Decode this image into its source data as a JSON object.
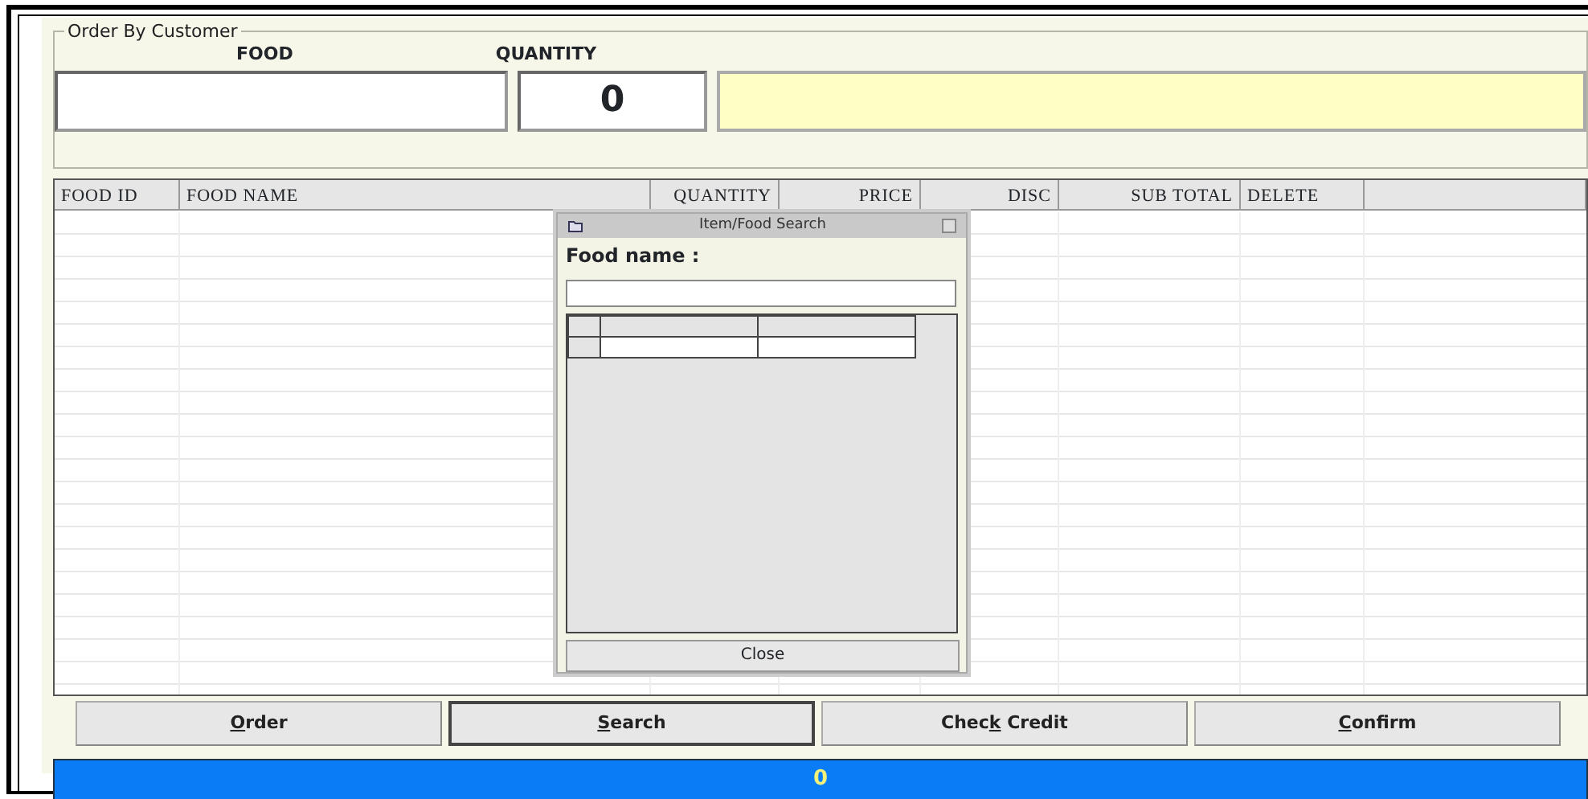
{
  "order_group": {
    "title": "Order By Customer",
    "food_label": "FOOD",
    "quantity_label": "QUANTITY",
    "quantity_value": "0"
  },
  "grid": {
    "columns": [
      {
        "label": "FOOD ID",
        "right_aligned": false
      },
      {
        "label": "FOOD NAME",
        "right_aligned": false
      },
      {
        "label": "QUANTITY",
        "right_aligned": true
      },
      {
        "label": "PRICE",
        "right_aligned": true
      },
      {
        "label": "DISC",
        "right_aligned": true
      },
      {
        "label": "SUB TOTAL",
        "right_aligned": true
      },
      {
        "label": "DELETE",
        "right_aligned": false
      }
    ]
  },
  "search_dialog": {
    "title": "Item/Food Search",
    "field_label": "Food name :",
    "close_button": "Close"
  },
  "buttons": [
    {
      "label_parts": [
        {
          "text": "O",
          "underlined": true
        },
        {
          "text": "rder",
          "underlined": false
        }
      ],
      "focused": false
    },
    {
      "label_parts": [
        {
          "text": "S",
          "underlined": true
        },
        {
          "text": "earch",
          "underlined": false
        }
      ],
      "focused": true
    },
    {
      "label_parts": [
        {
          "text": "Chec",
          "underlined": false
        },
        {
          "text": "k",
          "underlined": true
        },
        {
          "text": " Credit",
          "underlined": false
        }
      ],
      "focused": false
    },
    {
      "label_parts": [
        {
          "text": "C",
          "underlined": true
        },
        {
          "text": "onfirm",
          "underlined": false
        }
      ],
      "focused": false
    }
  ],
  "status_bar": {
    "total": "0"
  }
}
